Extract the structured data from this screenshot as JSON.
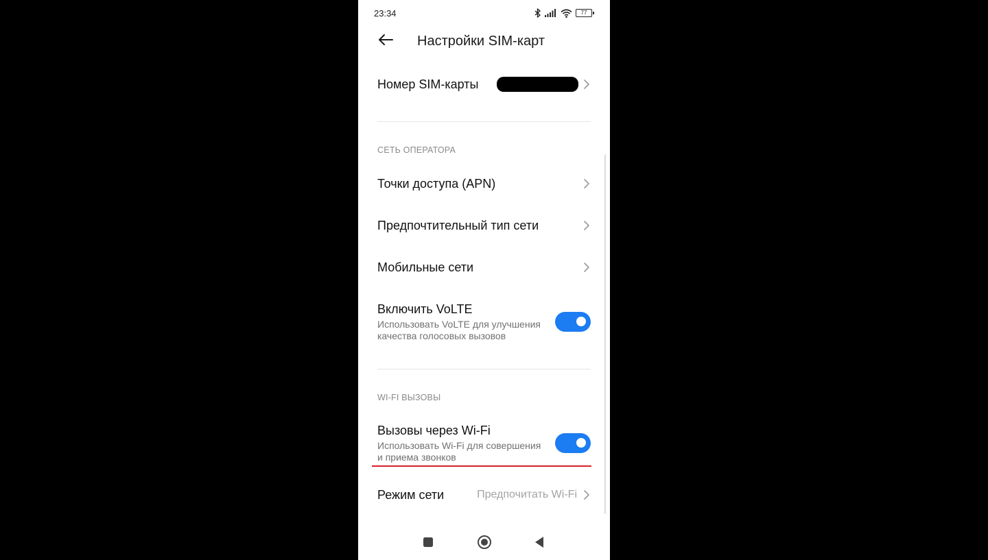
{
  "status_bar": {
    "time": "23:34",
    "icons": [
      "bluetooth-icon",
      "signal-icon",
      "wifi-icon",
      "battery-icon"
    ],
    "battery_level": "77"
  },
  "header": {
    "back_icon": "arrow-left-icon",
    "title": "Настройки SIM-карт"
  },
  "sim_number": {
    "label": "Номер SIM-карты",
    "value_redacted": true
  },
  "sections": {
    "operator_network": "СЕТЬ ОПЕРАТОРА",
    "wifi_calls": "WI-FI ВЫЗОВЫ"
  },
  "items": {
    "apn": {
      "label": "Точки доступа (APN)"
    },
    "preferred_network": {
      "label": "Предпочтительный тип сети"
    },
    "mobile_networks": {
      "label": "Мобильные сети"
    },
    "volte": {
      "title": "Включить VoLTE",
      "subtitle_line1": "Использовать VoLTE для улучшения",
      "subtitle_line2": "качества голосовых вызовов",
      "enabled": true
    },
    "wifi_calling": {
      "title": "Вызовы через Wi-Fi",
      "subtitle_line1": "Использовать Wi-Fi для совершения",
      "subtitle_line2": "и приема звонков",
      "enabled": true
    },
    "network_mode": {
      "label": "Режим сети",
      "value": "Предпочитать Wi-Fi"
    }
  },
  "colors": {
    "toggle_on": "#1c7cf2",
    "highlight_line": "#d81f26",
    "screen_background": "#ffffff",
    "outer_background": "#000000"
  },
  "nav_bar": [
    "recents-square-icon",
    "home-circle-icon",
    "back-triangle-icon"
  ]
}
